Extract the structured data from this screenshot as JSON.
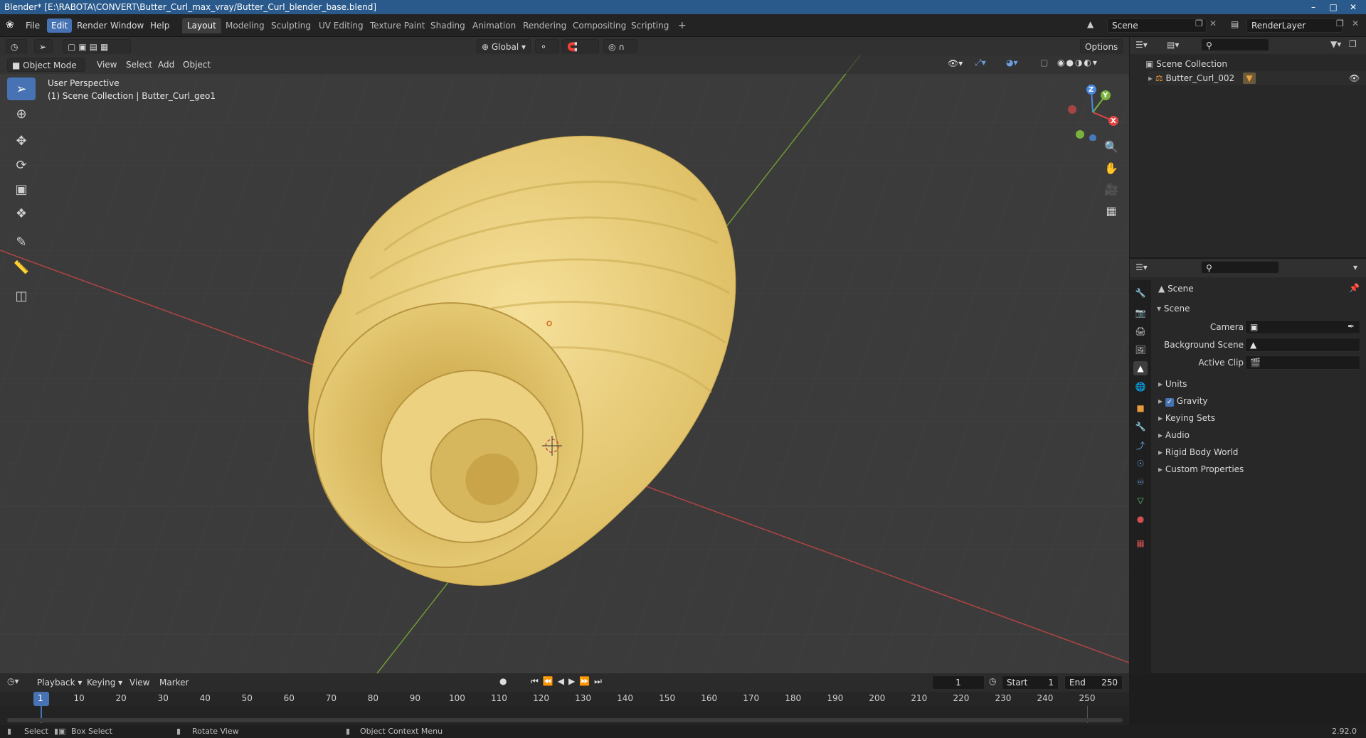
{
  "window": {
    "title": "Blender* [E:\\RABOTA\\CONVERT\\Butter_Curl_max_vray/Butter_Curl_blender_base.blend]",
    "version": "2.92.0"
  },
  "menu": [
    "File",
    "Edit",
    "Render",
    "Window",
    "Help"
  ],
  "workspaces": [
    "Layout",
    "Modeling",
    "Sculpting",
    "UV Editing",
    "Texture Paint",
    "Shading",
    "Animation",
    "Rendering",
    "Compositing",
    "Scripting"
  ],
  "top_right": {
    "scene": "Scene",
    "view_layer": "RenderLayer"
  },
  "viewport": {
    "transform_orientation": "Global",
    "options_label": "Options",
    "mode": "Object Mode",
    "header_menus": [
      "View",
      "Select",
      "Add",
      "Object"
    ],
    "overlay_title": "User Perspective",
    "overlay_subtitle": "(1) Scene Collection | Butter_Curl_geo1",
    "gizmo_axes": {
      "x": "X",
      "y": "Y",
      "z": "Z"
    }
  },
  "outliner": {
    "collection": "Scene Collection",
    "items": [
      "Butter_Curl_002"
    ]
  },
  "properties": {
    "context_title": "Scene",
    "panel_title": "Scene",
    "fields": [
      {
        "label": "Camera"
      },
      {
        "label": "Background Scene"
      },
      {
        "label": "Active Clip"
      }
    ],
    "subpanels": [
      {
        "label": "Units",
        "checkbox": false
      },
      {
        "label": "Gravity",
        "checkbox": true,
        "checked": true
      },
      {
        "label": "Keying Sets",
        "checkbox": false
      },
      {
        "label": "Audio",
        "checkbox": false
      },
      {
        "label": "Rigid Body World",
        "checkbox": false
      },
      {
        "label": "Custom Properties",
        "checkbox": false
      }
    ]
  },
  "timeline": {
    "menus": [
      "Playback",
      "Keying",
      "View",
      "Marker"
    ],
    "current_frame": "1",
    "start_label": "Start",
    "start": "1",
    "end_label": "End",
    "end": "250",
    "ticks": [
      "1",
      "10",
      "20",
      "30",
      "40",
      "50",
      "60",
      "70",
      "80",
      "90",
      "100",
      "110",
      "120",
      "130",
      "140",
      "150",
      "160",
      "170",
      "180",
      "190",
      "200",
      "210",
      "220",
      "230",
      "240",
      "250"
    ]
  },
  "statusbar": {
    "select": "Select",
    "box_select": "Box Select",
    "rotate_view": "Rotate View",
    "context_menu": "Object Context Menu"
  },
  "colors": {
    "accent": "#4772b3",
    "butter": "#f1d57e",
    "x_axis": "#c04848",
    "y_axis": "#7fa83a"
  }
}
